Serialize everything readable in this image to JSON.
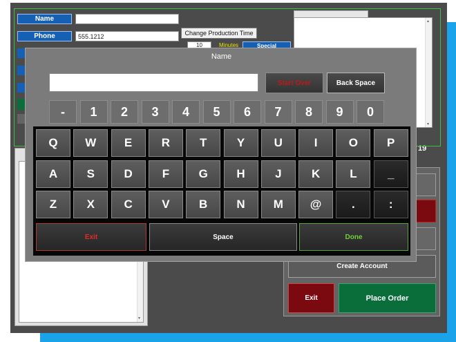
{
  "form": {
    "name_label": "Name",
    "name_value": "",
    "phone_label": "Phone",
    "phone_value": "555.1212",
    "change_production_btn": "Change Production Time",
    "minutes_value": "10",
    "minutes_label": "Minutes",
    "special_btn": "Special"
  },
  "right_panel": {
    "partial_number": "19",
    "create_account_btn": "Create Account",
    "exit_btn": "Exit",
    "place_order_btn": "Place Order"
  },
  "keyboard": {
    "title": "Name",
    "input_value": "",
    "start_over_btn": "Start Over",
    "back_space_btn": "Back Space",
    "number_keys": [
      "-",
      "1",
      "2",
      "3",
      "4",
      "5",
      "6",
      "7",
      "8",
      "9",
      "0"
    ],
    "row1": [
      "Q",
      "W",
      "E",
      "R",
      "T",
      "Y",
      "U",
      "I",
      "O",
      "P"
    ],
    "row2": [
      "A",
      "S",
      "D",
      "F",
      "G",
      "H",
      "J",
      "K",
      "L",
      "_"
    ],
    "row3": [
      "Z",
      "X",
      "C",
      "V",
      "B",
      "N",
      "M",
      "@",
      ".",
      ":"
    ],
    "exit_btn": "Exit",
    "space_btn": "Space",
    "done_btn": "Done"
  },
  "colors": {
    "accent": "#1aa3e8",
    "dark_red": "#7a0a10",
    "dark_green": "#0a6e3a",
    "done_green": "#6fd13a",
    "exit_red": "#e52a2a"
  }
}
